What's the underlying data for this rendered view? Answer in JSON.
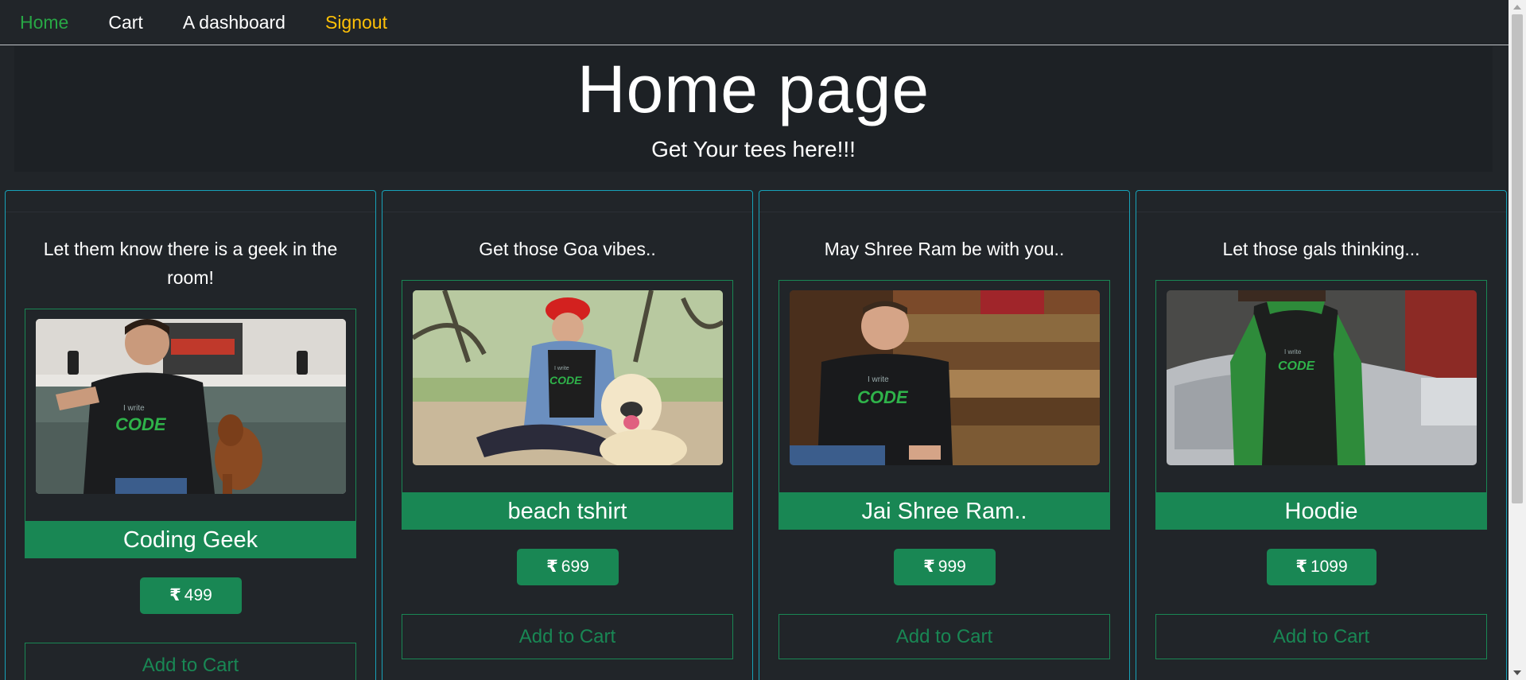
{
  "nav": {
    "home": "Home",
    "cart": "Cart",
    "dashboard": "A dashboard",
    "signout": "Signout"
  },
  "jumbotron": {
    "title": "Home page",
    "subtitle": "Get Your tees here!!!"
  },
  "currency_symbol": "₹",
  "products": [
    {
      "description": "Let them know there is a geek in the room!",
      "name": "Coding Geek",
      "price": "499",
      "add_to_cart": "Add to Cart"
    },
    {
      "description": "Get those Goa vibes..",
      "name": "beach tshirt",
      "price": "699",
      "add_to_cart": "Add to Cart"
    },
    {
      "description": "May Shree Ram be with you..",
      "name": "Jai Shree Ram..",
      "price": "999",
      "add_to_cart": "Add to Cart"
    },
    {
      "description": "Let those gals thinking...",
      "name": "Hoodie",
      "price": "1099",
      "add_to_cart": "Add to Cart"
    }
  ],
  "tshirt_print": {
    "line1": "I write",
    "line2": "CODE"
  },
  "colors": {
    "brand_green": "#198754",
    "home_link": "#28a745",
    "signout_link": "#ffc107",
    "card_border": "#17a2b8",
    "background": "#212529"
  }
}
